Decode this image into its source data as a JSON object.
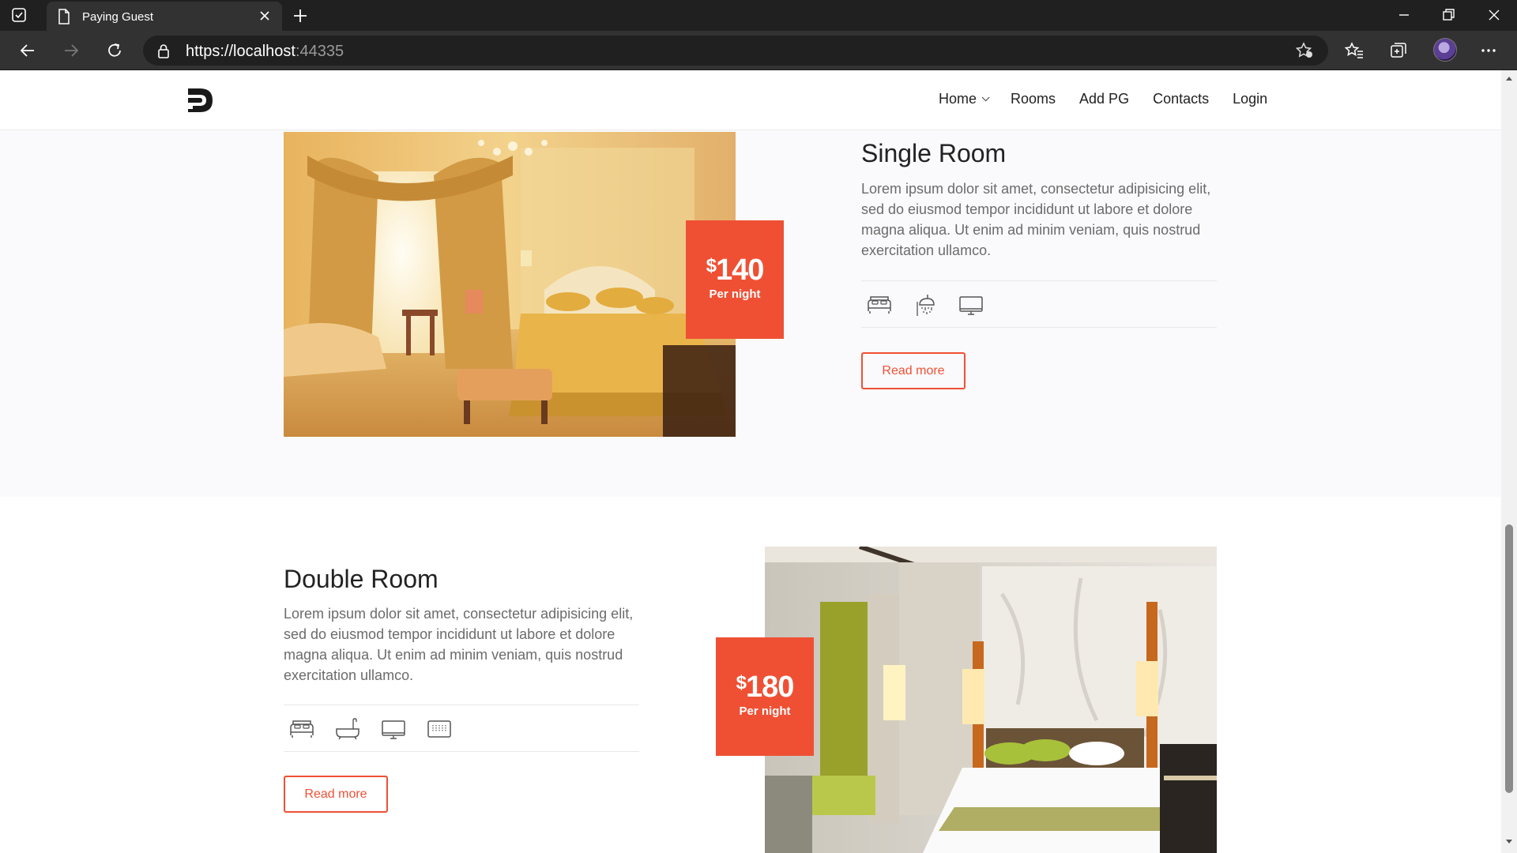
{
  "browser": {
    "tab_title": "Paying Guest",
    "url_main": "https://localhost",
    "url_port": ":44335"
  },
  "site": {
    "nav": [
      {
        "label": "Home"
      },
      {
        "label": "Rooms"
      },
      {
        "label": "Add PG"
      },
      {
        "label": "Contacts"
      },
      {
        "label": "Login"
      }
    ]
  },
  "rooms": [
    {
      "title": "Single Room",
      "description": "Lorem ipsum dolor sit amet, consectetur adipisicing elit, sed do eiusmod tempor incididunt ut labore et dolore magna aliqua. Ut enim ad minim veniam, quis nostrud exercitation ullamco.",
      "price": "140",
      "price_prefix": "$",
      "price_unit": "Per night",
      "amenities": [
        "bed-icon",
        "shower-icon",
        "tv-icon"
      ],
      "button": "Read more"
    },
    {
      "title": "Double Room",
      "description": "Lorem ipsum dolor sit amet, consectetur adipisicing elit, sed do eiusmod tempor incididunt ut labore et dolore magna aliqua. Ut enim ad minim veniam, quis nostrud exercitation ullamco.",
      "price": "180",
      "price_prefix": "$",
      "price_unit": "Per night",
      "amenities": [
        "bed-icon",
        "bathtub-icon",
        "tv-icon",
        "keyboard-icon"
      ],
      "button": "Read more"
    }
  ],
  "colors": {
    "accent": "#ef5034",
    "chrome_dark": "#202020",
    "chrome_mid": "#323232",
    "section_bg": "#fafafc"
  }
}
